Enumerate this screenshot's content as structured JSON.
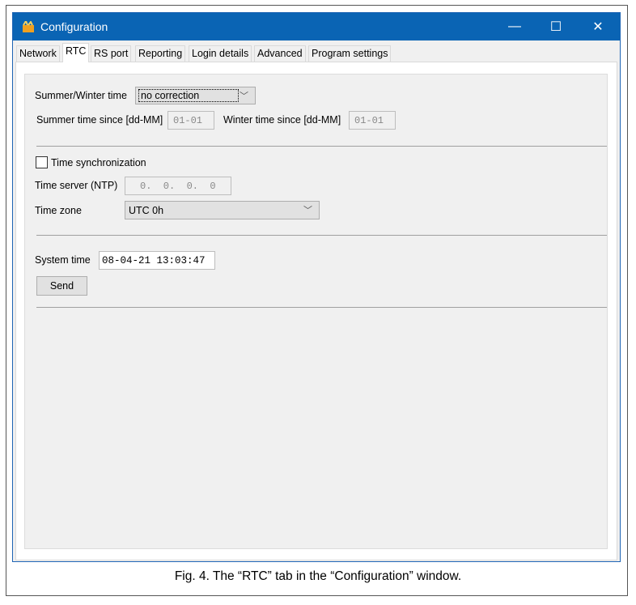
{
  "window": {
    "title": "Configuration",
    "controls": {
      "minimize": "—",
      "maximize": "☐",
      "close": "✕"
    }
  },
  "tabs": [
    {
      "label": "Network"
    },
    {
      "label": "RTC",
      "active": true
    },
    {
      "label": "RS port"
    },
    {
      "label": "Reporting"
    },
    {
      "label": "Login details"
    },
    {
      "label": "Advanced"
    },
    {
      "label": "Program settings"
    }
  ],
  "dst": {
    "label": "Summer/Winter time",
    "value": "no correction",
    "summer_label": "Summer time since [dd-MM]",
    "summer_value": "01-01",
    "winter_label": "Winter time since [dd-MM]",
    "winter_value": "01-01"
  },
  "sync": {
    "checkbox_label": "Time synchronization",
    "checked": false,
    "ntp_label": "Time server (NTP)",
    "ntp_value": "0.  0.  0.  0",
    "tz_label": "Time zone",
    "tz_value": "UTC 0h"
  },
  "system": {
    "label": "System time",
    "value": "08-04-21 13:03:47",
    "send_label": "Send"
  },
  "caption": "Fig. 4. The “RTC” tab in the “Configuration” window."
}
